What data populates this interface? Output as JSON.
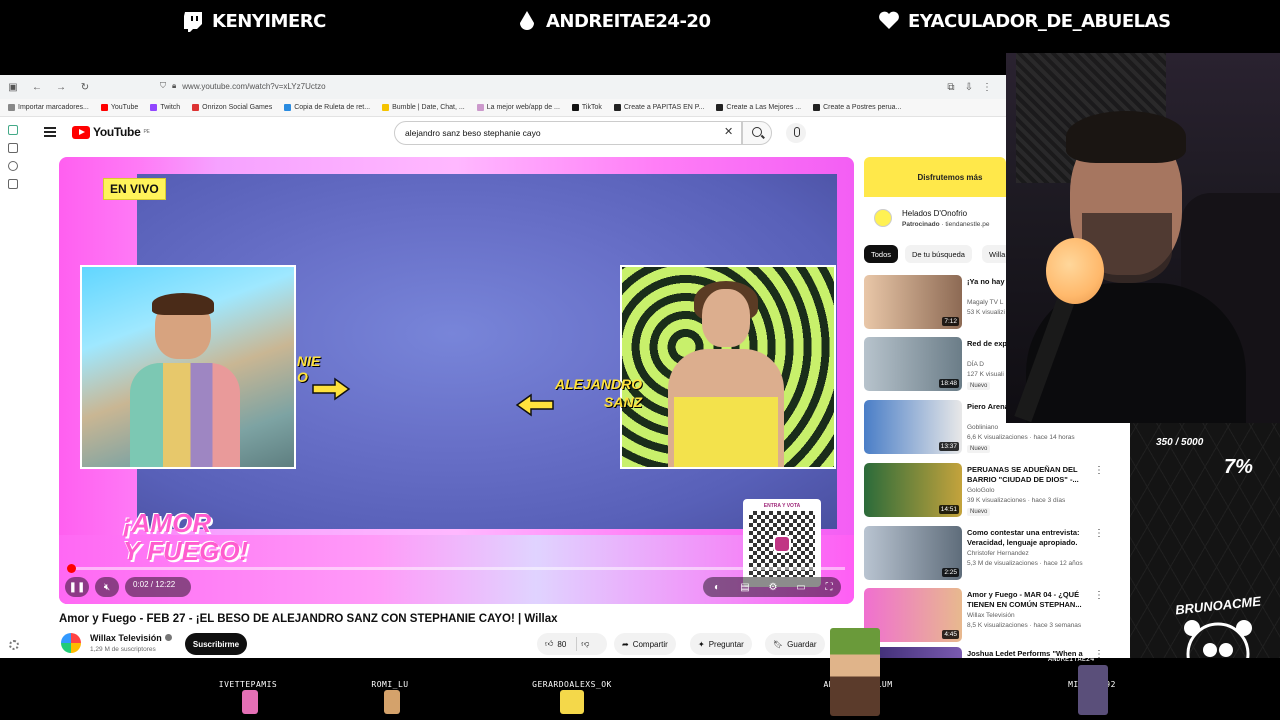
{
  "stream": {
    "top_names": [
      "KENYIMERC",
      "ANDREITAE24-20",
      "EYACULADOR_DE_ABUELAS"
    ],
    "goal_text": "350 / 5000",
    "goal_percent": "7%",
    "brand": "BRUNOACME",
    "viewers": [
      "IVETTEPAMIS",
      "ROMI_LU",
      "GERARDOALEXS_OK",
      "ANGELIQUEBLUM",
      "MISHEL092"
    ],
    "overlay_names": [
      "BRUNOACME",
      "ANDREITAE24"
    ]
  },
  "browser": {
    "url": "www.youtube.com/watch?v=xLYz7Uctzo",
    "bookmarks": [
      "Importar marcadores...",
      "YouTube",
      "Twitch",
      "Onrizon Social Games",
      "Copia de Ruleta de ret...",
      "Bumble | Date, Chat, ...",
      "La mejor web/app de ...",
      "TikTok",
      "Create a PAPITAS EN P...",
      "Create a Las Mejores ...",
      "Create a Postres perua..."
    ]
  },
  "youtube": {
    "logo": "YouTube",
    "region": "PE",
    "search_query": "alejandro sanz beso stephanie cayo",
    "player": {
      "live_badge": "EN VIVO",
      "tag_left_1": "NIE",
      "tag_left_2": "O",
      "tag_right_1": "ALEJANDRO",
      "tag_right_2": "SANZ",
      "show_name_1": "¡AMOR",
      "show_name_2": "Y FUEGO!",
      "qr_title": "ENTRA Y VOTA",
      "time": "0:02 / 12:22",
      "progress": 0.003
    },
    "video_title": "Amor y Fuego - FEB 27 - ¡EL BESO DE ALEJANDRO SANZ CON STEPHANIE CAYO! | Willax",
    "channel": "Willax Televisión",
    "subscribers": "1,29 M de suscriptores",
    "subscribe_label": "Suscribirme",
    "likes": "80",
    "share_label": "Compartir",
    "ask_label": "Preguntar",
    "save_label": "Guardar"
  },
  "ad": {
    "banner": "Disfrutemos más",
    "name": "Helados D'Onofrio",
    "sponsored": "Patrocinado",
    "domain": "tiendanestle.pe"
  },
  "chips": [
    "Todos",
    "De tu búsqueda",
    "Willa"
  ],
  "suggestions": [
    {
      "title": "¡Ya no hay ... Alejandro S",
      "channel": "Magaly TV L",
      "views": "53 K visualizi",
      "duration": "7:12",
      "badge": ""
    },
    {
      "title": "Red de exp ofrecía esc",
      "channel": "DÍA D",
      "views": "127 K visuali",
      "duration": "18:48",
      "badge": "Nuevo"
    },
    {
      "title": "Piero Arena",
      "channel": "Gobliniano",
      "views": "6,6 K visualizaciones · hace 14 horas",
      "duration": "13:37",
      "badge": "Nuevo"
    },
    {
      "title": "PERUANAS SE ADUEÑAN DEL BARRIO \"CIUDAD DE DIOS\" -...",
      "channel": "GoloGolo",
      "views": "39 K visualizaciones · hace 3 días",
      "duration": "14:51",
      "badge": "Nuevo"
    },
    {
      "title": "Como contestar una entrevista: Veracidad, lenguaje apropiado.",
      "channel": "Christofer Hernandez",
      "views": "5,3 M de visualizaciones · hace 12 años",
      "duration": "2:25",
      "badge": ""
    },
    {
      "title": "Amor y Fuego - MAR 04 - ¿QUÉ TIENEN EN COMÚN STEPHAN...",
      "channel": "Willax Televisión",
      "views": "8,5 K visualizaciones · hace 3 semanas",
      "duration": "4:45",
      "badge": ""
    },
    {
      "title": "Joshua Ledet Performs \"When a",
      "channel": "",
      "views": "",
      "duration": "",
      "badge": ""
    }
  ],
  "colors": {
    "accent_red": "#ff0000",
    "live_yellow": "#fff35a",
    "stream_pink": "#ff5ff0"
  }
}
